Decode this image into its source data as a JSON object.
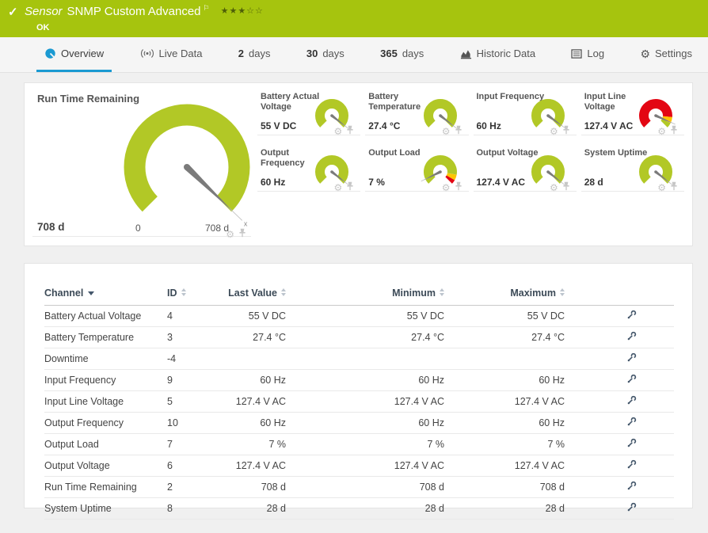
{
  "colors": {
    "green": "#b2c826",
    "red": "#e30613",
    "yellow": "#fdc500",
    "header_green": "#a6c40e",
    "blue": "#1b9ad2",
    "needle": "#7b7b7b"
  },
  "header": {
    "check": "✓",
    "title_prefix": "Sensor",
    "title": "SNMP Custom Advanced",
    "flag": "⚐",
    "stars": {
      "filled": 3,
      "total": 5
    },
    "status": "OK"
  },
  "tabs": [
    {
      "label": "Overview",
      "icon": "gauge",
      "active": true
    },
    {
      "label": "Live Data",
      "icon": "live"
    },
    {
      "prefix": "2",
      "label": "days"
    },
    {
      "prefix": "30",
      "label": "days"
    },
    {
      "prefix": "365",
      "label": "days"
    },
    {
      "label": "Historic Data",
      "icon": "chart"
    },
    {
      "label": "Log",
      "icon": "log"
    },
    {
      "label": "Settings",
      "icon": "gear"
    }
  ],
  "gauges": {
    "main": {
      "title": "Run Time Remaining",
      "value": "708 d",
      "scale_min": "0",
      "scale_max": "708 d",
      "needle_deg": -44,
      "segments": [
        [
          225,
          -45,
          "green"
        ]
      ]
    },
    "small": [
      {
        "title": "Battery Actual Voltage",
        "value": "55 V DC",
        "needle_deg": -38,
        "segments": [
          [
            225,
            -45,
            "green"
          ]
        ]
      },
      {
        "title": "Battery Temperature",
        "value": "27.4 °C",
        "needle_deg": -38,
        "segments": [
          [
            225,
            -45,
            "green"
          ]
        ]
      },
      {
        "title": "Input Frequency",
        "value": "60 Hz",
        "needle_deg": -36,
        "segments": [
          [
            225,
            -45,
            "green"
          ]
        ]
      },
      {
        "title": "Input Line Voltage",
        "value": "127.4 V AC",
        "needle_deg": -24,
        "segments": [
          [
            225,
            -5,
            "red"
          ],
          [
            -5,
            -27,
            "yellow"
          ],
          [
            -27,
            -45,
            "green"
          ]
        ]
      },
      {
        "title": "Output Frequency",
        "value": "60 Hz",
        "needle_deg": -38,
        "segments": [
          [
            225,
            -45,
            "green"
          ]
        ]
      },
      {
        "title": "Output Load",
        "value": "7 %",
        "needle_deg": 206,
        "segments": [
          [
            225,
            -10,
            "green"
          ],
          [
            -10,
            -30,
            "yellow"
          ],
          [
            -30,
            -45,
            "red"
          ]
        ]
      },
      {
        "title": "Output Voltage",
        "value": "127.4 V AC",
        "needle_deg": -38,
        "segments": [
          [
            225,
            -45,
            "green"
          ]
        ]
      },
      {
        "title": "System Uptime",
        "value": "28 d",
        "needle_deg": -38,
        "segments": [
          [
            225,
            -45,
            "green"
          ]
        ]
      }
    ]
  },
  "table": {
    "columns": [
      {
        "label": "Channel",
        "sort": "desc"
      },
      {
        "label": "ID",
        "sort": "both"
      },
      {
        "label": "Last Value",
        "sort": "both"
      },
      {
        "label": "Minimum",
        "sort": "both"
      },
      {
        "label": "Maximum",
        "sort": "both"
      }
    ],
    "rows": [
      {
        "channel": "Battery Actual Voltage",
        "id": "4",
        "last": "55 V DC",
        "min": "55 V DC",
        "max": "55 V DC"
      },
      {
        "channel": "Battery Temperature",
        "id": "3",
        "last": "27.4 °C",
        "min": "27.4 °C",
        "max": "27.4 °C"
      },
      {
        "channel": "Downtime",
        "id": "-4",
        "last": "",
        "min": "",
        "max": ""
      },
      {
        "channel": "Input Frequency",
        "id": "9",
        "last": "60 Hz",
        "min": "60 Hz",
        "max": "60 Hz"
      },
      {
        "channel": "Input Line Voltage",
        "id": "5",
        "last": "127.4 V AC",
        "min": "127.4 V AC",
        "max": "127.4 V AC"
      },
      {
        "channel": "Output Frequency",
        "id": "10",
        "last": "60 Hz",
        "min": "60 Hz",
        "max": "60 Hz"
      },
      {
        "channel": "Output Load",
        "id": "7",
        "last": "7 %",
        "min": "7 %",
        "max": "7 %"
      },
      {
        "channel": "Output Voltage",
        "id": "6",
        "last": "127.4 V AC",
        "min": "127.4 V AC",
        "max": "127.4 V AC"
      },
      {
        "channel": "Run Time Remaining",
        "id": "2",
        "last": "708 d",
        "min": "708 d",
        "max": "708 d"
      },
      {
        "channel": "System Uptime",
        "id": "8",
        "last": "28 d",
        "min": "28 d",
        "max": "28 d"
      }
    ]
  }
}
